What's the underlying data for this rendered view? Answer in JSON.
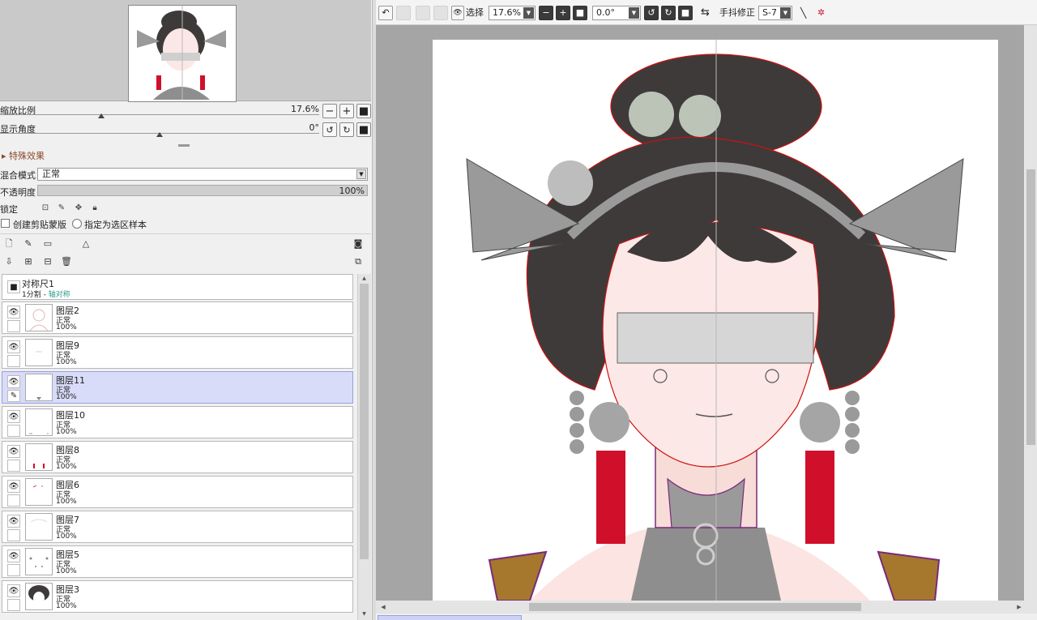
{
  "navigator": {
    "zoom_label": "缩放比例",
    "zoom_value": "17.6%",
    "angle_label": "显示角度",
    "angle_value": "0°"
  },
  "effects": {
    "header": "▸ 特殊效果",
    "blend_label": "混合模式",
    "blend_value": "正常",
    "opacity_label": "不透明度",
    "opacity_value": "100%",
    "lock_label": "锁定",
    "clip_label": "创建剪贴蒙版",
    "sample_label": "指定为选区样本"
  },
  "ruler_layer": {
    "name": "对称尺1",
    "sub_prefix": "1分割 - ",
    "sub_mode": "轴对称"
  },
  "layers": [
    {
      "name": "图层2",
      "mode": "正常",
      "opacity": "100%"
    },
    {
      "name": "图层9",
      "mode": "正常",
      "opacity": "100%"
    },
    {
      "name": "图层11",
      "mode": "正常",
      "opacity": "100%"
    },
    {
      "name": "图层10",
      "mode": "正常",
      "opacity": "100%"
    },
    {
      "name": "图层8",
      "mode": "正常",
      "opacity": "100%"
    },
    {
      "name": "图层6",
      "mode": "正常",
      "opacity": "100%"
    },
    {
      "name": "图层7",
      "mode": "正常",
      "opacity": "100%"
    },
    {
      "name": "图层5",
      "mode": "正常",
      "opacity": "100%"
    },
    {
      "name": "图层3",
      "mode": "正常",
      "opacity": "100%"
    }
  ],
  "selected_layer": "图层11",
  "toolbar": {
    "selection_label": "选择",
    "zoom_value": "17.6%",
    "angle_value": "0.0°",
    "stabilizer_label": "手抖修正",
    "stabilizer_value": "S-7"
  },
  "colors": {
    "accent_selected": "#d8dcf8",
    "ink_red": "#d0102a",
    "hair": "#3e3a3a"
  }
}
